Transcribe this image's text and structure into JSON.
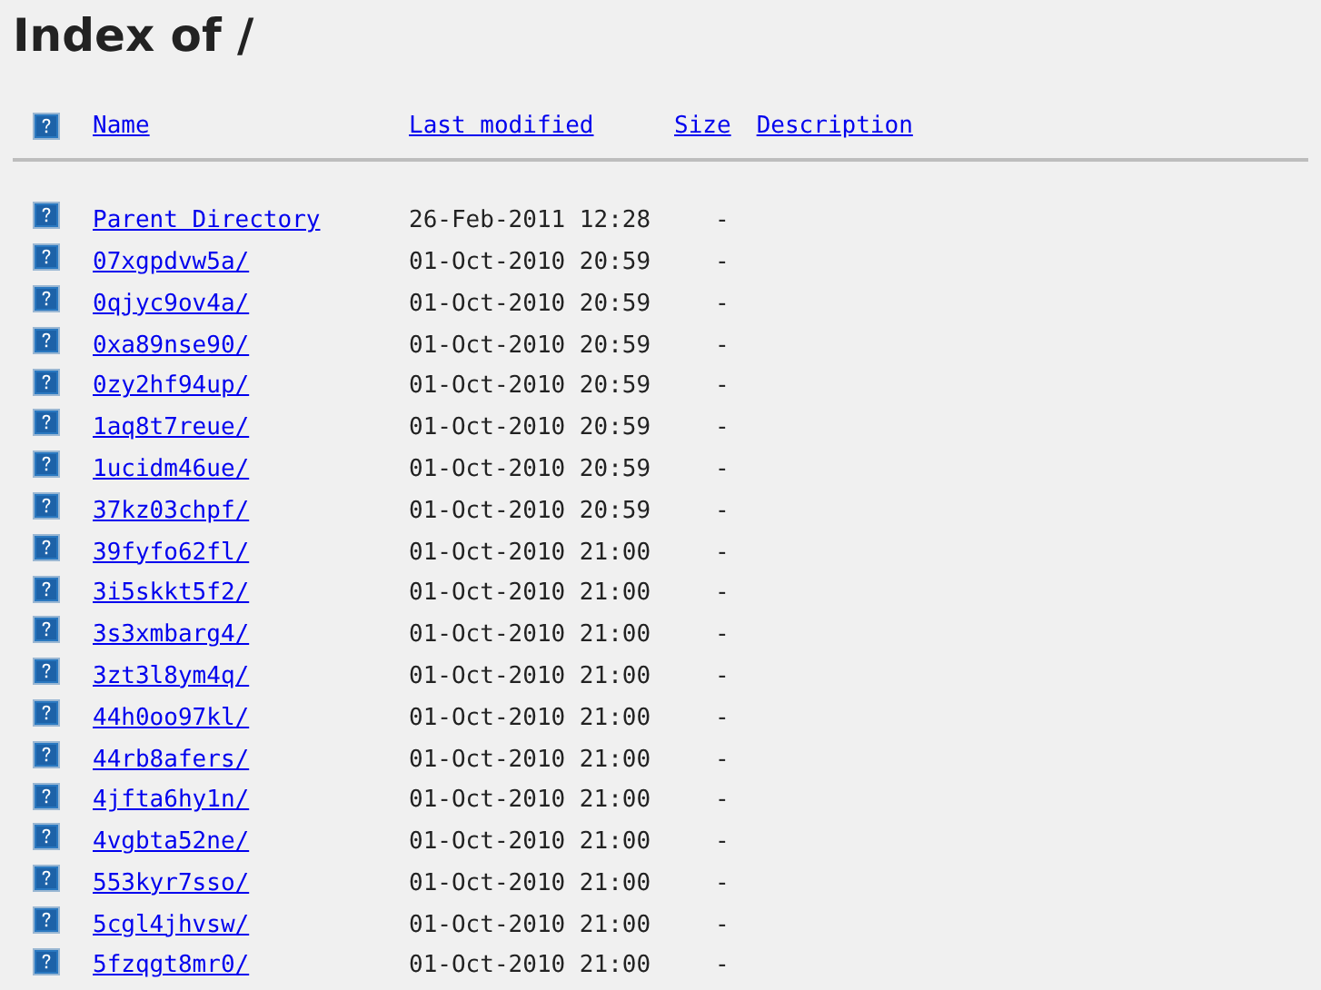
{
  "title": "Index of /",
  "columns": [
    {
      "label": "Name"
    },
    {
      "label": "Last modified"
    },
    {
      "label": "Size"
    },
    {
      "label": "Description"
    }
  ],
  "rows": [
    {
      "name": "Parent Directory",
      "modified": "26-Feb-2011 12:28",
      "size": "-"
    },
    {
      "name": "07xgpdvw5a/",
      "modified": "01-Oct-2010 20:59",
      "size": "-"
    },
    {
      "name": "0qjyc9ov4a/",
      "modified": "01-Oct-2010 20:59",
      "size": "-"
    },
    {
      "name": "0xa89nse90/",
      "modified": "01-Oct-2010 20:59",
      "size": "-"
    },
    {
      "name": "0zy2hf94up/",
      "modified": "01-Oct-2010 20:59",
      "size": "-"
    },
    {
      "name": "1aq8t7reue/",
      "modified": "01-Oct-2010 20:59",
      "size": "-"
    },
    {
      "name": "1ucidm46ue/",
      "modified": "01-Oct-2010 20:59",
      "size": "-"
    },
    {
      "name": "37kz03chpf/",
      "modified": "01-Oct-2010 20:59",
      "size": "-"
    },
    {
      "name": "39fyfo62fl/",
      "modified": "01-Oct-2010 21:00",
      "size": "-"
    },
    {
      "name": "3i5skkt5f2/",
      "modified": "01-Oct-2010 21:00",
      "size": "-"
    },
    {
      "name": "3s3xmbarg4/",
      "modified": "01-Oct-2010 21:00",
      "size": "-"
    },
    {
      "name": "3zt3l8ym4q/",
      "modified": "01-Oct-2010 21:00",
      "size": "-"
    },
    {
      "name": "44h0oo97kl/",
      "modified": "01-Oct-2010 21:00",
      "size": "-"
    },
    {
      "name": "44rb8afers/",
      "modified": "01-Oct-2010 21:00",
      "size": "-"
    },
    {
      "name": "4jfta6hy1n/",
      "modified": "01-Oct-2010 21:00",
      "size": "-"
    },
    {
      "name": "4vgbta52ne/",
      "modified": "01-Oct-2010 21:00",
      "size": "-"
    },
    {
      "name": "553kyr7sso/",
      "modified": "01-Oct-2010 21:00",
      "size": "-"
    },
    {
      "name": "5cgl4jhvsw/",
      "modified": "01-Oct-2010 21:00",
      "size": "-"
    },
    {
      "name": "5fzqgt8mr0/",
      "modified": "01-Oct-2010 21:00",
      "size": "-"
    }
  ]
}
